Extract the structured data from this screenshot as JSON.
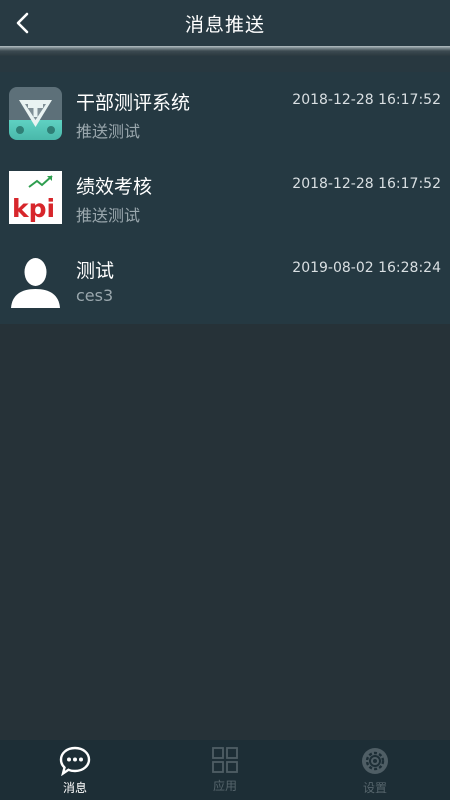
{
  "header": {
    "title": "消息推送",
    "back_icon": "chevron-left-icon"
  },
  "messages": [
    {
      "title": "干部测评系统",
      "subtitle": "推送测试",
      "time": "2018-12-28 16:17:52",
      "avatar": "cadre-evaluation-app-icon"
    },
    {
      "title": "绩效考核",
      "subtitle": "推送测试",
      "time": "2018-12-28 16:17:52",
      "avatar": "kpi-app-icon",
      "avatar_text": "kpi"
    },
    {
      "title": "测试",
      "subtitle": "ces3",
      "time": "2019-08-02 16:28:24",
      "avatar": "user-silhouette-icon"
    }
  ],
  "tabbar": {
    "tabs": [
      {
        "label": "消息",
        "icon": "chat-bubble-icon",
        "active": true
      },
      {
        "label": "应用",
        "icon": "grid-icon",
        "active": false
      },
      {
        "label": "设置",
        "icon": "gear-icon",
        "active": false
      }
    ]
  },
  "colors": {
    "background": "#263238",
    "header": "#283a43",
    "list": "#253942",
    "tabbar": "#1d2e36",
    "kpi_red": "#d7262b",
    "kpi_green": "#2e9e4f"
  }
}
